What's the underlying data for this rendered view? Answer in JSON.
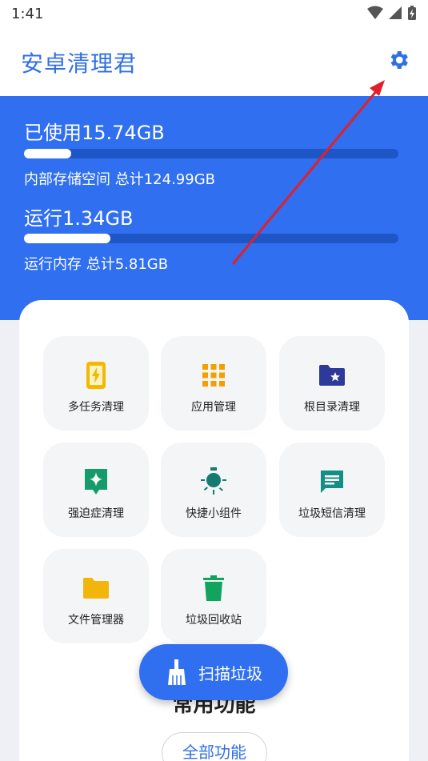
{
  "status_bar": {
    "time": "1:41"
  },
  "app_bar": {
    "title": "安卓清理君",
    "settings_icon": "gear-icon"
  },
  "storage": {
    "used_label": "已使用15.74GB",
    "used_fraction": 0.126,
    "total_label": "内部存储空间 总计124.99GB"
  },
  "memory": {
    "run_label": "运行1.34GB",
    "run_fraction": 0.23,
    "total_label": "运行内存 总计5.81GB"
  },
  "tiles": [
    {
      "label": "多任务清理",
      "icon": "phone-bolt-icon",
      "color": "#f5b800"
    },
    {
      "label": "应用管理",
      "icon": "grid-icon",
      "color": "#f59e00"
    },
    {
      "label": "根目录清理",
      "icon": "folder-star-icon",
      "color": "#2e3a9a"
    },
    {
      "label": "强迫症清理",
      "icon": "sparkle-badge-icon",
      "color": "#169b6d"
    },
    {
      "label": "快捷小组件",
      "icon": "lightbulb-icon",
      "color": "#157a70"
    },
    {
      "label": "垃圾短信清理",
      "icon": "message-icon",
      "color": "#138f86"
    },
    {
      "label": "文件管理器",
      "icon": "folder-icon",
      "color": "#f2b50a"
    },
    {
      "label": "垃圾回收站",
      "icon": "trash-icon",
      "color": "#14a35f"
    }
  ],
  "section_title": "常用功能",
  "all_features_label": "全部功能",
  "fab": {
    "label": "扫描垃圾",
    "icon": "broom-icon"
  },
  "colors": {
    "primary": "#2f6ff0",
    "accent_arrow": "#e0202a"
  }
}
